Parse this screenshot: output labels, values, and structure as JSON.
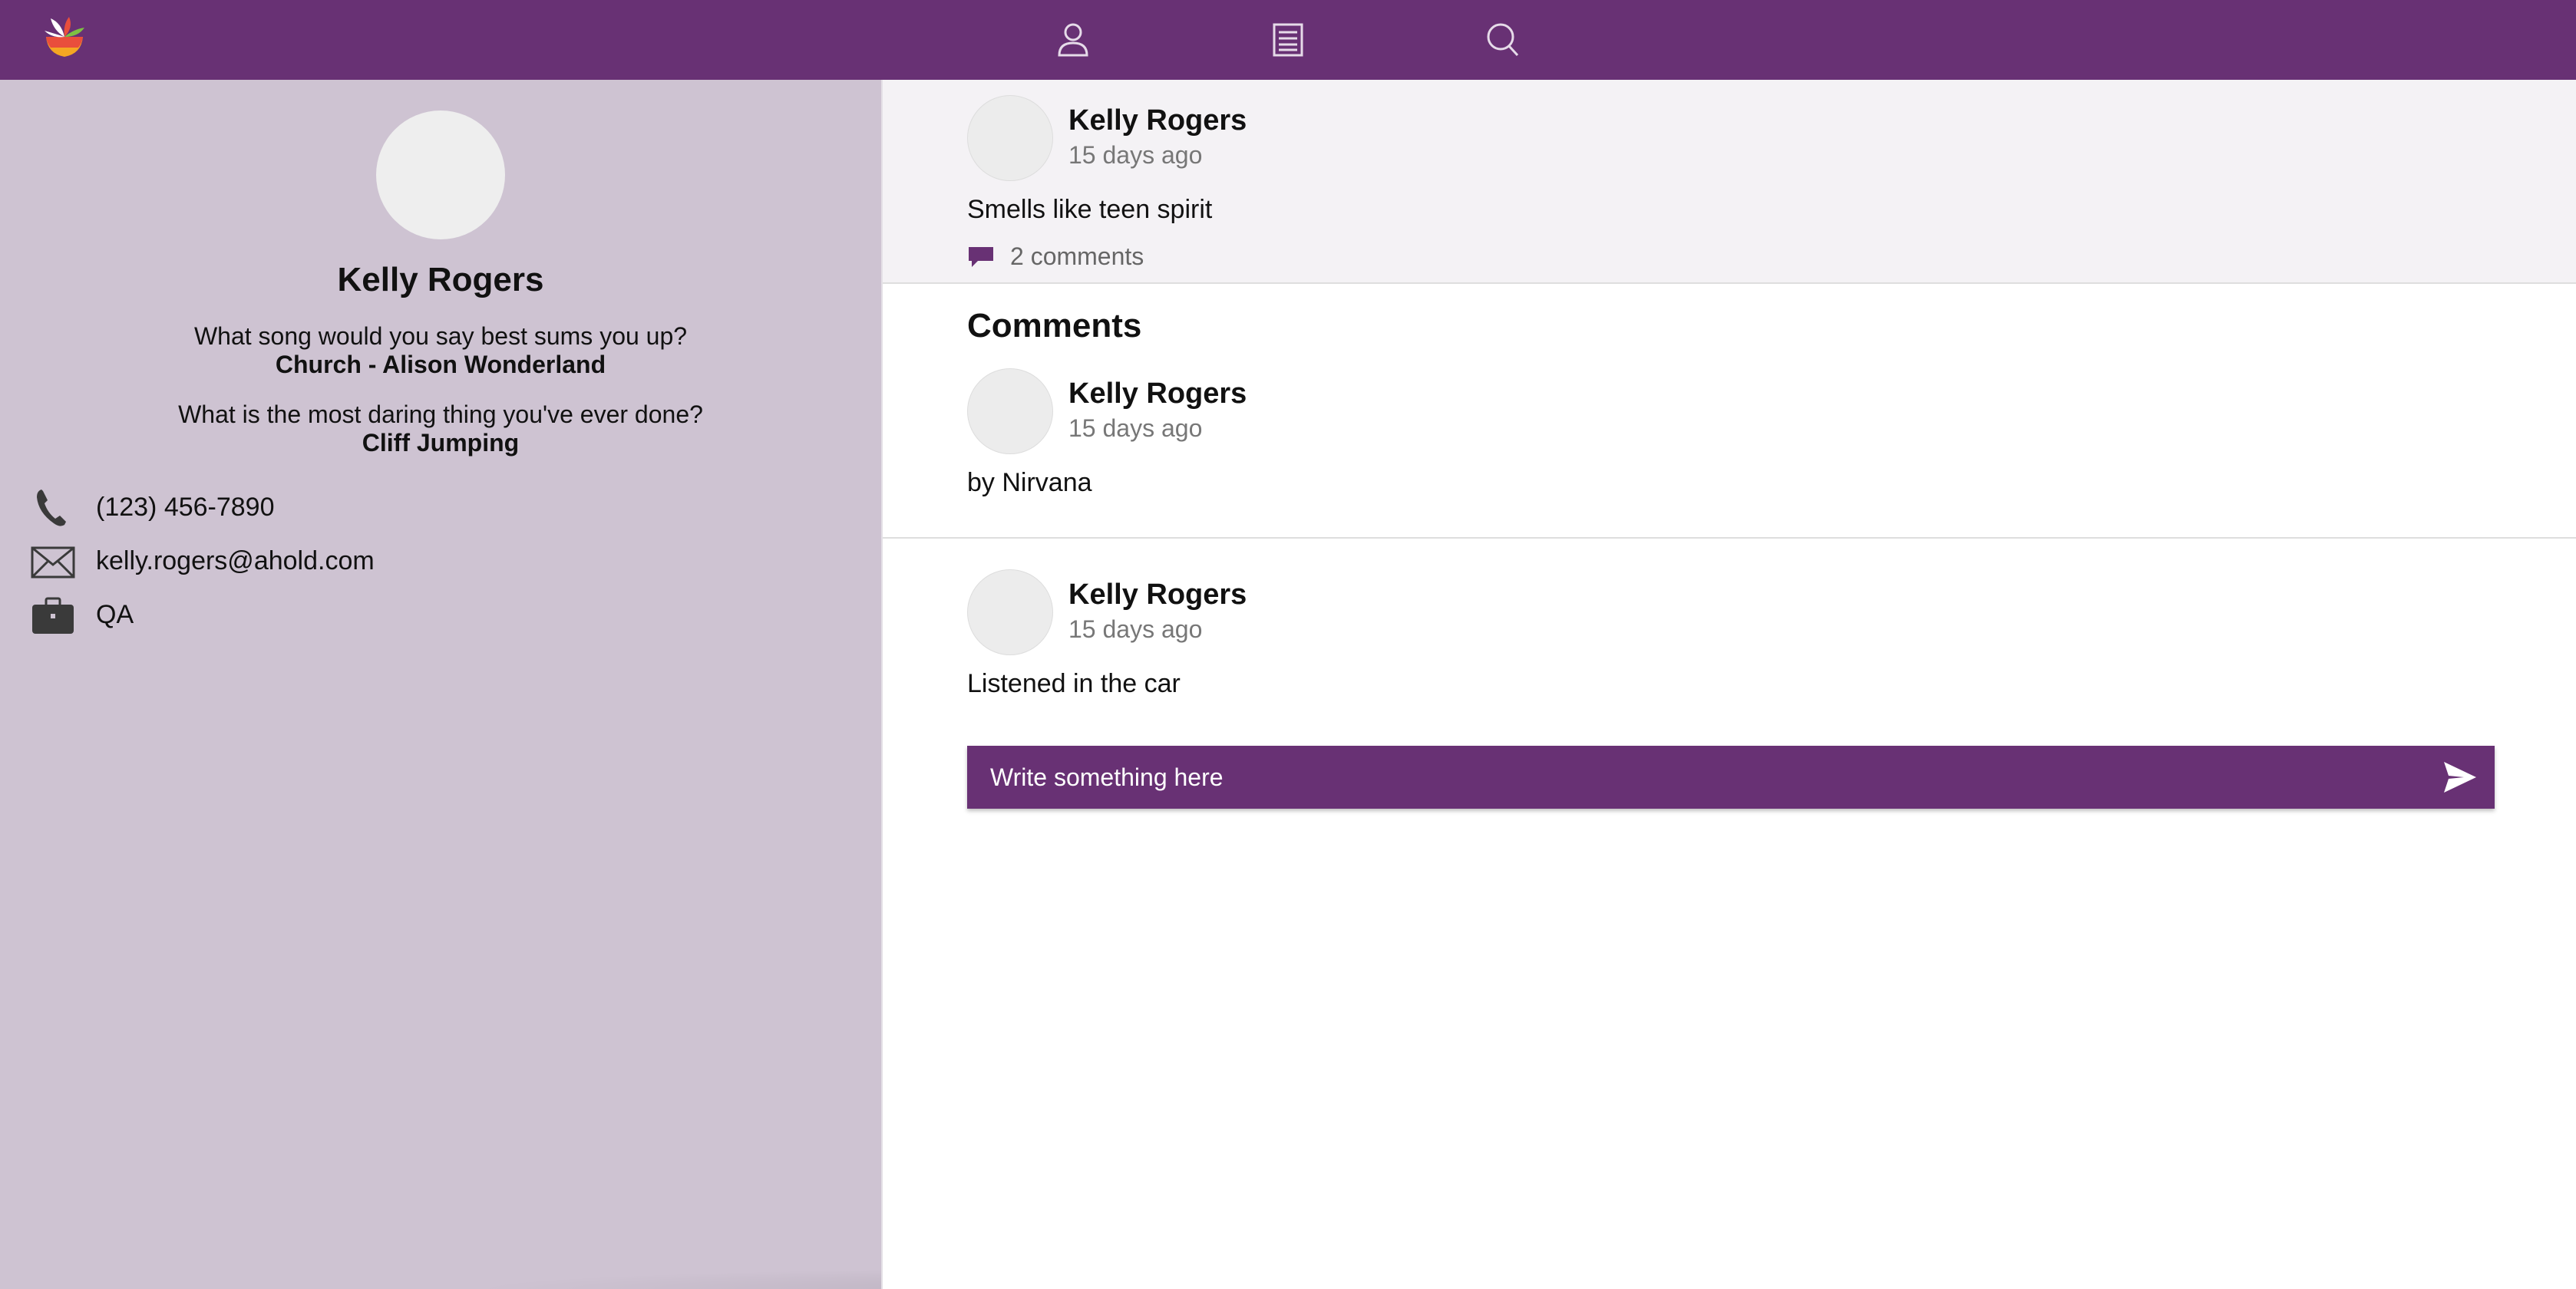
{
  "app": {
    "brand_colors": {
      "primary": "#683174",
      "sidebar": "#cec3d2",
      "post_bg": "#f4f2f5"
    },
    "nav": {
      "icons": [
        "logo-icon",
        "user-icon",
        "feed-icon",
        "search-icon"
      ]
    }
  },
  "profile": {
    "name": "Kelly Rogers",
    "questions": [
      {
        "question": "What song would you say best sums you up?",
        "answer": "Church - Alison Wonderland"
      },
      {
        "question": "What is the most daring thing you've ever done?",
        "answer": "Cliff Jumping"
      }
    ],
    "contact": {
      "phone": "(123) 456-7890",
      "email": "kelly.rogers@ahold.com",
      "department": "QA"
    }
  },
  "post": {
    "author": "Kelly Rogers",
    "time": "15 days ago",
    "text": "Smells like teen spirit",
    "comment_count_label": "2 comments"
  },
  "comments": {
    "heading": "Comments",
    "items": [
      {
        "author": "Kelly Rogers",
        "time": "15 days ago",
        "text": "by Nirvana"
      },
      {
        "author": "Kelly Rogers",
        "time": "15 days ago",
        "text": "Listened in the car"
      }
    ]
  },
  "composer": {
    "placeholder": "Write something here",
    "value": ""
  }
}
